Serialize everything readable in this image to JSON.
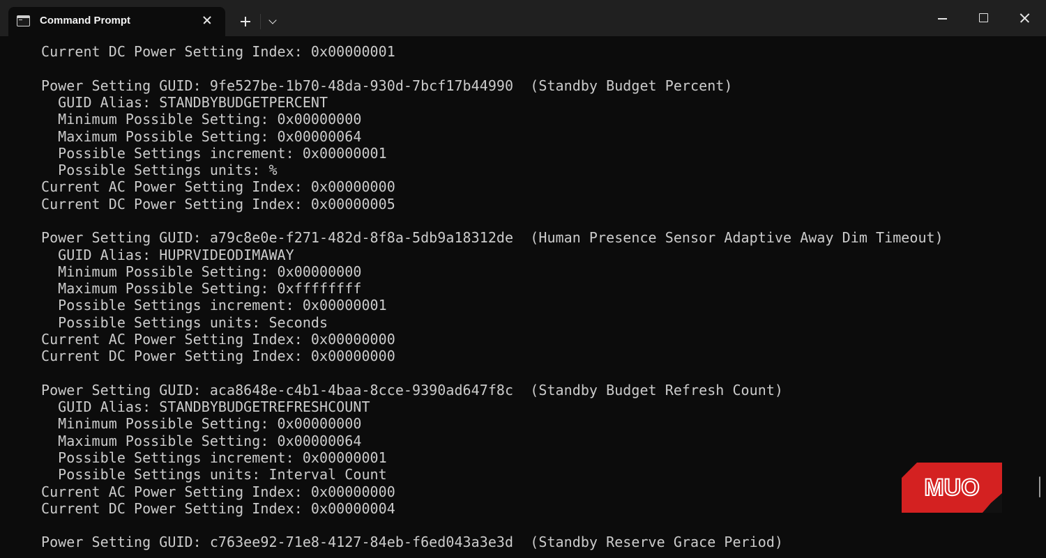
{
  "tab": {
    "title": "Command Prompt"
  },
  "terminal": {
    "lines": [
      "Current DC Power Setting Index: 0x00000001",
      "",
      "Power Setting GUID: 9fe527be-1b70-48da-930d-7bcf17b44990  (Standby Budget Percent)",
      "  GUID Alias: STANDBYBUDGETPERCENT",
      "  Minimum Possible Setting: 0x00000000",
      "  Maximum Possible Setting: 0x00000064",
      "  Possible Settings increment: 0x00000001",
      "  Possible Settings units: %",
      "Current AC Power Setting Index: 0x00000000",
      "Current DC Power Setting Index: 0x00000005",
      "",
      "Power Setting GUID: a79c8e0e-f271-482d-8f8a-5db9a18312de  (Human Presence Sensor Adaptive Away Dim Timeout)",
      "  GUID Alias: HUPRVIDEODIMAWAY",
      "  Minimum Possible Setting: 0x00000000",
      "  Maximum Possible Setting: 0xffffffff",
      "  Possible Settings increment: 0x00000001",
      "  Possible Settings units: Seconds",
      "Current AC Power Setting Index: 0x00000000",
      "Current DC Power Setting Index: 0x00000000",
      "",
      "Power Setting GUID: aca8648e-c4b1-4baa-8cce-9390ad647f8c  (Standby Budget Refresh Count)",
      "  GUID Alias: STANDBYBUDGETREFRESHCOUNT",
      "  Minimum Possible Setting: 0x00000000",
      "  Maximum Possible Setting: 0x00000064",
      "  Possible Settings increment: 0x00000001",
      "  Possible Settings units: Interval Count",
      "Current AC Power Setting Index: 0x00000000",
      "Current DC Power Setting Index: 0x00000004",
      "",
      "Power Setting GUID: c763ee92-71e8-4127-84eb-f6ed043a3e3d  (Standby Reserve Grace Period)"
    ]
  },
  "watermark": {
    "text": "MUO",
    "color": "#d42121"
  },
  "colors": {
    "background": "#0c0c0c",
    "titlebar": "#202020",
    "text": "#cccccc"
  },
  "icons": {
    "tab_icon": "command-prompt-icon",
    "close_tab": "close-icon",
    "new_tab": "plus-icon",
    "dropdown": "chevron-down-icon",
    "minimize": "minimize-icon",
    "maximize": "maximize-icon",
    "close_window": "close-icon"
  }
}
